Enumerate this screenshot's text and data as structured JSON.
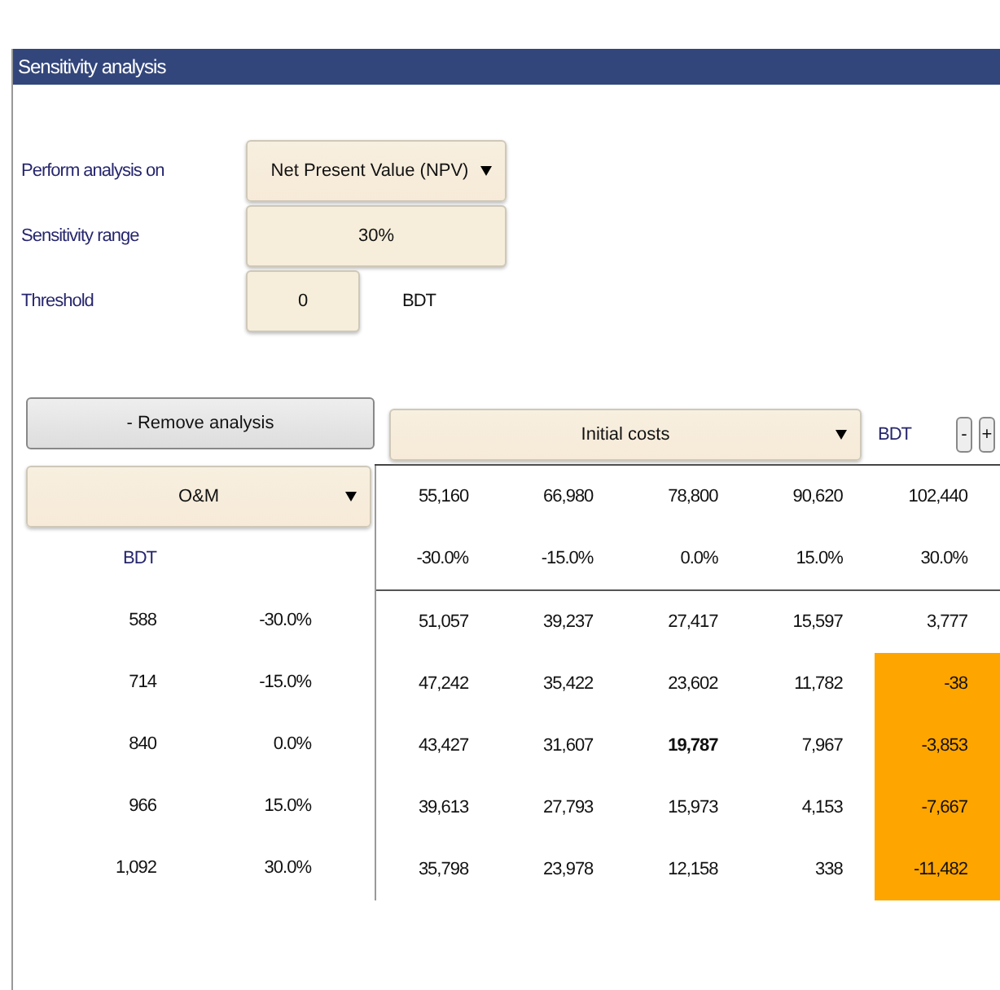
{
  "panel": {
    "title": "Sensitivity analysis"
  },
  "form": {
    "analysis_label": "Perform analysis on",
    "analysis_value": "Net Present Value (NPV)",
    "range_label": "Sensitivity range",
    "range_value": "30%",
    "threshold_label": "Threshold",
    "threshold_value": "0",
    "threshold_unit": "BDT"
  },
  "toolbar": {
    "remove_button": "- Remove analysis",
    "column_variable": "Initial costs",
    "column_unit": "BDT",
    "minus_button": "-",
    "plus_button": "+"
  },
  "table": {
    "row_variable": "O&M",
    "row_unit": "BDT",
    "column_values": [
      "55,160",
      "66,980",
      "78,800",
      "90,620",
      "102,440"
    ],
    "column_changes": [
      "-30.0%",
      "-15.0%",
      "0.0%",
      "15.0%",
      "30.0%"
    ],
    "rows": [
      {
        "value": "588",
        "change": "-30.0%",
        "cells": [
          {
            "text": "51,057",
            "below_threshold": false,
            "base": false
          },
          {
            "text": "39,237",
            "below_threshold": false,
            "base": false
          },
          {
            "text": "27,417",
            "below_threshold": false,
            "base": false
          },
          {
            "text": "15,597",
            "below_threshold": false,
            "base": false
          },
          {
            "text": "3,777",
            "below_threshold": false,
            "base": false
          }
        ]
      },
      {
        "value": "714",
        "change": "-15.0%",
        "cells": [
          {
            "text": "47,242",
            "below_threshold": false,
            "base": false
          },
          {
            "text": "35,422",
            "below_threshold": false,
            "base": false
          },
          {
            "text": "23,602",
            "below_threshold": false,
            "base": false
          },
          {
            "text": "11,782",
            "below_threshold": false,
            "base": false
          },
          {
            "text": "-38",
            "below_threshold": true,
            "base": false
          }
        ]
      },
      {
        "value": "840",
        "change": "0.0%",
        "cells": [
          {
            "text": "43,427",
            "below_threshold": false,
            "base": false
          },
          {
            "text": "31,607",
            "below_threshold": false,
            "base": false
          },
          {
            "text": "19,787",
            "below_threshold": false,
            "base": true
          },
          {
            "text": "7,967",
            "below_threshold": false,
            "base": false
          },
          {
            "text": "-3,853",
            "below_threshold": true,
            "base": false
          }
        ]
      },
      {
        "value": "966",
        "change": "15.0%",
        "cells": [
          {
            "text": "39,613",
            "below_threshold": false,
            "base": false
          },
          {
            "text": "27,793",
            "below_threshold": false,
            "base": false
          },
          {
            "text": "15,973",
            "below_threshold": false,
            "base": false
          },
          {
            "text": "4,153",
            "below_threshold": false,
            "base": false
          },
          {
            "text": "-7,667",
            "below_threshold": true,
            "base": false
          }
        ]
      },
      {
        "value": "1,092",
        "change": "30.0%",
        "cells": [
          {
            "text": "35,798",
            "below_threshold": false,
            "base": false
          },
          {
            "text": "23,978",
            "below_threshold": false,
            "base": false
          },
          {
            "text": "12,158",
            "below_threshold": false,
            "base": false
          },
          {
            "text": "338",
            "below_threshold": false,
            "base": false
          },
          {
            "text": "-11,482",
            "below_threshold": true,
            "base": false
          }
        ]
      }
    ]
  }
}
